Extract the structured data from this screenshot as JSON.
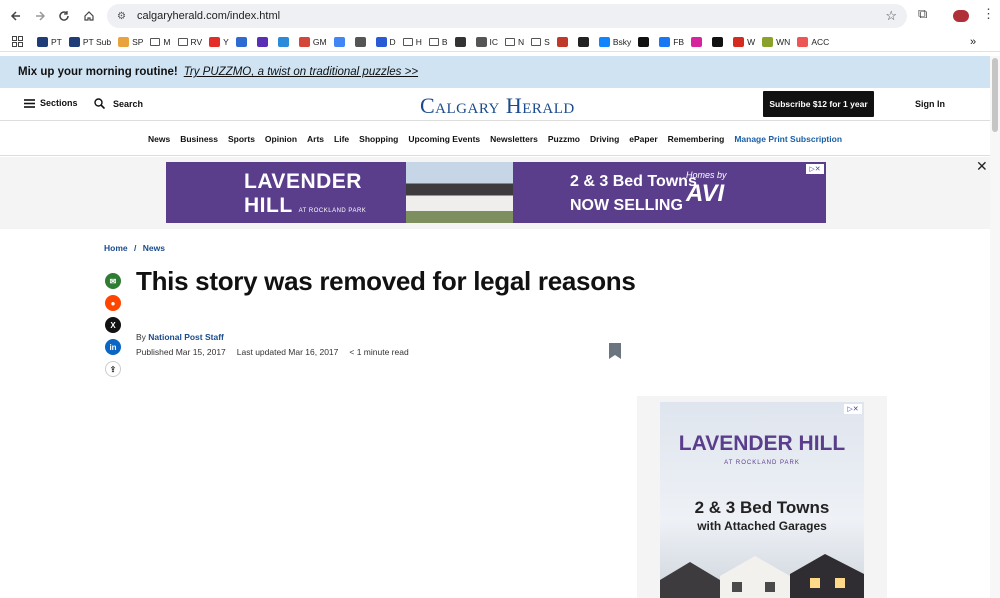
{
  "browser": {
    "url": "calgaryherald.com/index.html",
    "bookmarks": [
      {
        "label": "PT",
        "icon": "sis-icon",
        "color": "#1d3c78"
      },
      {
        "label": "PT Sub",
        "icon": "sis-icon",
        "color": "#1d3c78"
      },
      {
        "label": "SP",
        "icon": "windows-icon",
        "color": "#e8a33d"
      },
      {
        "label": "M",
        "icon": "folder-icon",
        "color": ""
      },
      {
        "label": "RV",
        "icon": "folder-icon",
        "color": ""
      },
      {
        "label": "Y",
        "icon": "youtube-icon",
        "color": "#e52d27"
      },
      {
        "label": "",
        "icon": "r-icon",
        "color": "#2d6bd0"
      },
      {
        "label": "",
        "icon": "mail-icon",
        "color": "#5b2fb5"
      },
      {
        "label": "",
        "icon": "s-icon",
        "color": "#2b8bd8"
      },
      {
        "label": "GM",
        "icon": "gmail-icon",
        "color": "#d44638"
      },
      {
        "label": "",
        "icon": "google-icon",
        "color": "#4285f4"
      },
      {
        "label": "",
        "icon": "wikipedia-icon",
        "color": "#555"
      },
      {
        "label": "D",
        "icon": "d-icon",
        "color": "#2a5bd7"
      },
      {
        "label": "H",
        "icon": "folder-icon",
        "color": ""
      },
      {
        "label": "B",
        "icon": "folder-icon",
        "color": ""
      },
      {
        "label": "",
        "icon": "ae-icon",
        "color": "#333"
      },
      {
        "label": "IC",
        "icon": "apple-icon",
        "color": "#555"
      },
      {
        "label": "N",
        "icon": "folder-icon",
        "color": ""
      },
      {
        "label": "S",
        "icon": "folder-icon",
        "color": ""
      },
      {
        "label": "",
        "icon": "fan-icon",
        "color": "#c0392b"
      },
      {
        "label": "",
        "icon": "nhl-icon",
        "color": "#222"
      },
      {
        "label": "Bsky",
        "icon": "butterfly-icon",
        "color": "#1185fe"
      },
      {
        "label": "",
        "icon": "x-icon",
        "color": "#111"
      },
      {
        "label": "FB",
        "icon": "facebook-icon",
        "color": "#1877f2"
      },
      {
        "label": "",
        "icon": "instagram-icon",
        "color": "#d6249f"
      },
      {
        "label": "",
        "icon": "tiktok-icon",
        "color": "#111"
      },
      {
        "label": "W",
        "icon": "maple-leaf-icon",
        "color": "#d52b1e"
      },
      {
        "label": "WN",
        "icon": "wn-icon",
        "color": "#8aa12c"
      },
      {
        "label": "ACC",
        "icon": "acc-icon",
        "color": "#e55"
      }
    ]
  },
  "promo": {
    "text": "Mix up your morning routine!",
    "link": "Try PUZZMO, a twist on traditional puzzles >>"
  },
  "header": {
    "sections_label": "Sections",
    "search_label": "Search",
    "logo": "Calgary Herald",
    "subscribe_label": "Subscribe $12 for 1 year",
    "signin_label": "Sign In"
  },
  "nav": [
    "News",
    "Business",
    "Sports",
    "Opinion",
    "Arts",
    "Life",
    "Shopping",
    "Upcoming Events",
    "Newsletters",
    "Puzzmo",
    "Driving",
    "ePaper",
    "Remembering"
  ],
  "nav_accent": "Manage Print Subscription",
  "ad_leaderboard": {
    "logo_line1": "LAVENDER",
    "logo_line2": "HILL",
    "logo_sub": "AT ROCKLAND PARK",
    "line1": "2 & 3 Bed Towns",
    "line2": "NOW SELLING",
    "brand_small": "Homes by",
    "brand": "AVI"
  },
  "breadcrumb": {
    "home": "Home",
    "sep": "/",
    "section": "News"
  },
  "article": {
    "headline": "This story was removed for legal reasons",
    "by_prefix": "By",
    "author": "National Post Staff",
    "published": "Published Mar 15, 2017",
    "updated": "Last updated Mar 16, 2017",
    "read_time": "< 1 minute read"
  },
  "ad_sidebar": {
    "logo": "LAVENDER HILL",
    "sub": "AT ROCKLAND PARK",
    "line1": "2 & 3 Bed Towns",
    "line2": "with Attached Garages"
  },
  "colors": {
    "brand_blue": "#1a4b8c",
    "promo_bg": "#cfe3f2",
    "ad_purple": "#5a3e8c"
  }
}
